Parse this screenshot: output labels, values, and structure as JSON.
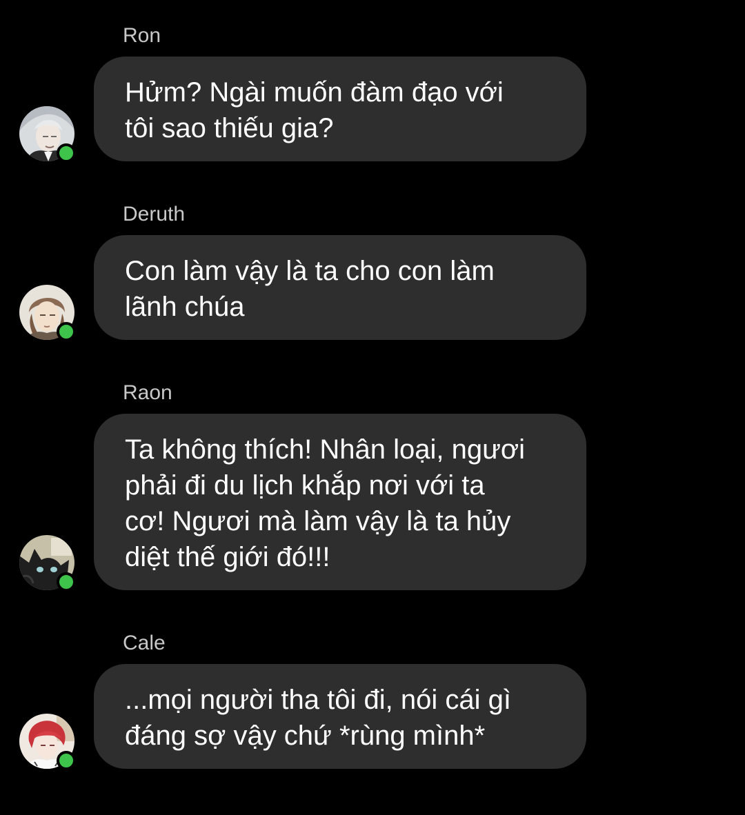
{
  "colors": {
    "background": "#000000",
    "bubble": "#2e2e2e",
    "sender_name": "#c8c8c8",
    "message_text": "#ffffff",
    "online_indicator": "#3ec44b"
  },
  "messages": [
    {
      "sender": "Ron",
      "text": "Hửm? Ngài muốn đàm đạo với\ntôi sao thiếu gia?",
      "avatar_icon": "avatar-ron",
      "online": true
    },
    {
      "sender": "Deruth",
      "text": "Con làm vậy là ta cho con làm\nlãnh chúa",
      "avatar_icon": "avatar-deruth",
      "online": true
    },
    {
      "sender": "Raon",
      "text": "Ta không thích! Nhân loại, ngươi\nphải đi du lịch khắp nơi với ta\ncơ! Ngươi mà làm vậy là ta hủy\ndiệt thế giới đó!!!",
      "avatar_icon": "avatar-raon",
      "online": true
    },
    {
      "sender": "Cale",
      "text": "...mọi người tha tôi đi, nói cái gì\nđáng sợ vậy chứ *rùng mình*",
      "avatar_icon": "avatar-cale",
      "online": true
    }
  ]
}
